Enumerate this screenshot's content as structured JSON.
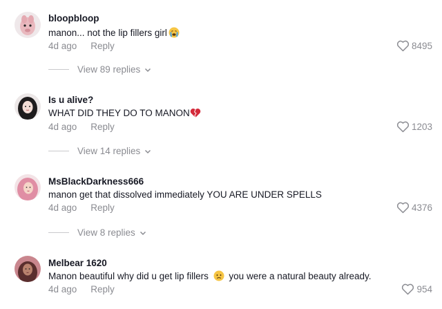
{
  "comments": [
    {
      "username": "bloopbloop",
      "text": "manon... not the lip fillers girl",
      "text_emoji": "crying-face",
      "time": "4d ago",
      "reply_label": "Reply",
      "likes": "8495",
      "view_replies": "View 89 replies",
      "avatar_color": "#d9a9b0"
    },
    {
      "username": "Is u alive?",
      "text": "WHAT DID THEY DO TO MANON",
      "text_emoji": "broken-heart",
      "time": "4d ago",
      "reply_label": "Reply",
      "likes": "1203",
      "view_replies": "View 14 replies",
      "avatar_color": "#2b2b2b"
    },
    {
      "username": "MsBlackDarkness666",
      "text": "manon get that dissolved immediately YOU ARE UNDER SPELLS",
      "time": "4d ago",
      "reply_label": "Reply",
      "likes": "4376",
      "view_replies": "View 8 replies",
      "avatar_color": "#e7a5b4"
    },
    {
      "username": "Melbear 1620",
      "text": "Manon beautiful why did u get lip fillers",
      "text_after": "you were a natural beauty already.",
      "text_emoji": "worried-face",
      "time": "4d ago",
      "reply_label": "Reply",
      "likes": "954",
      "avatar_color": "#b86a7a"
    }
  ],
  "colors": {
    "primary_text": "#161823",
    "secondary_text": "#8a8b91"
  }
}
